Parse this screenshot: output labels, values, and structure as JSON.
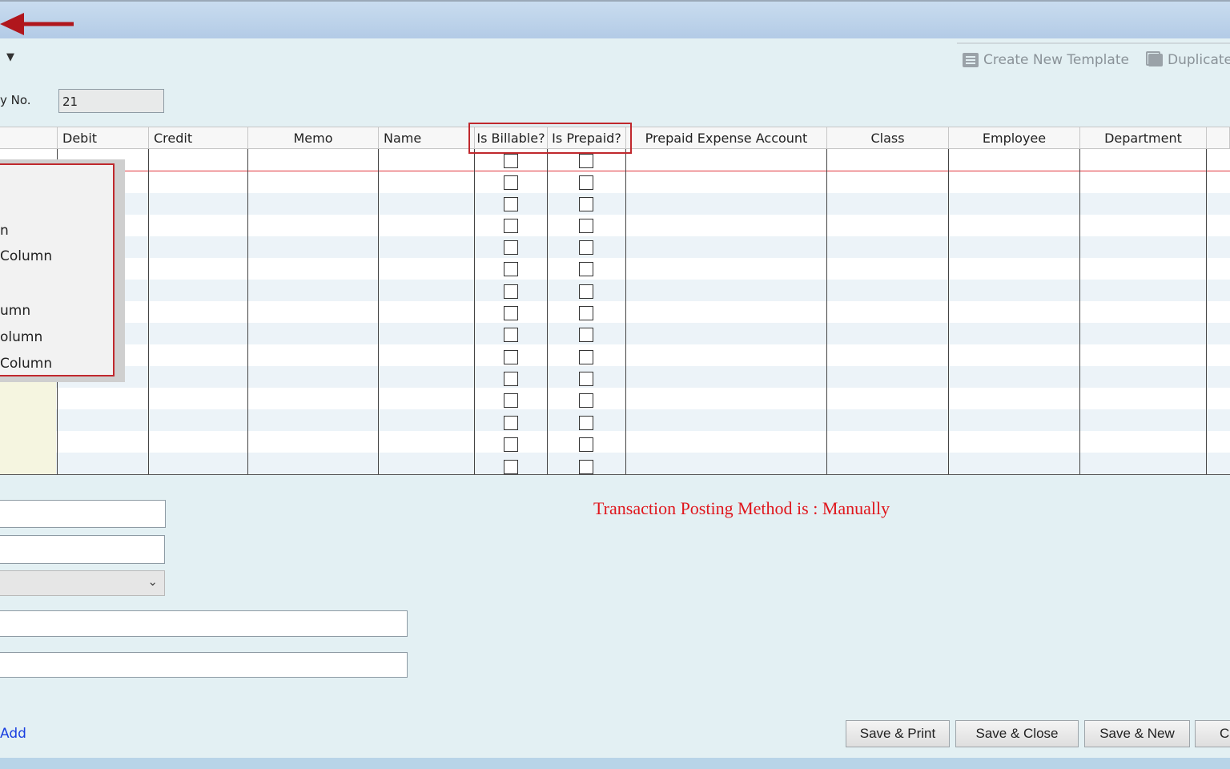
{
  "toolbar": {
    "create_template_label": "Create New Template",
    "duplicate_label": "Duplicate"
  },
  "entry": {
    "label": "y No.",
    "value": "21"
  },
  "grid": {
    "headers": [
      "Debit",
      "Credit",
      "Memo",
      "Name",
      "Is Billable?",
      "Is Prepaid?",
      "Prepaid Expense Account",
      "Class",
      "Employee",
      "Department"
    ]
  },
  "context_menu": {
    "items": [
      "n",
      " Column",
      "umn",
      "olumn",
      "Column"
    ]
  },
  "posting_message": "Transaction Posting Method is : Manually",
  "footer": {
    "add_link": "Add",
    "buttons": [
      "Save & Print",
      "Save & Close",
      "Save & New",
      "Cl"
    ]
  },
  "colors": {
    "highlight": "#c0282d",
    "posting_text": "#e0161c",
    "link": "#1a3fe0"
  }
}
